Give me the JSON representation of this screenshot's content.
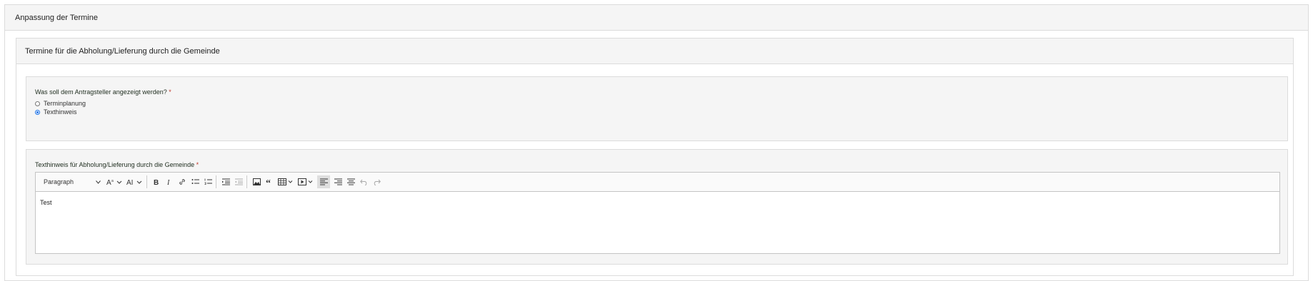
{
  "section": {
    "title": "Anpassung der Termine",
    "panel_title": "Termine für die Abholung/Lieferung durch die Gemeinde",
    "question": "Was soll dem Antragsteller angezeigt werden?",
    "required_mark": "*",
    "options": [
      {
        "label": "Terminplanung",
        "selected": false
      },
      {
        "label": "Texthinweis",
        "selected": true
      }
    ],
    "editor_label": "Texthinweis für Abholung/Lieferung durch die Gemeinde",
    "editor": {
      "paragraph_label": "Paragraph",
      "content": "Test",
      "active_tool": "align-left",
      "accent_color": "#1a73e8"
    }
  }
}
